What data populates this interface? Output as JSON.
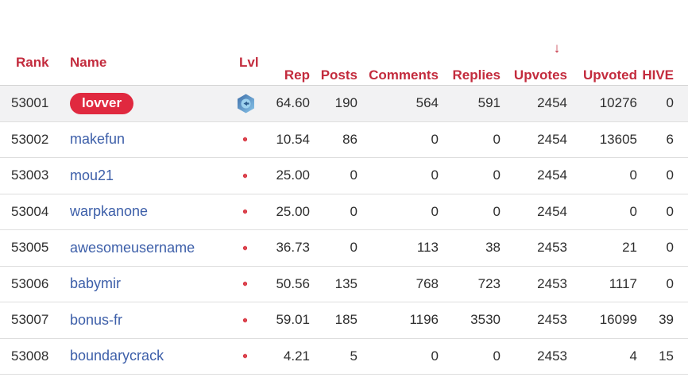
{
  "colors": {
    "header_red": "#c32b3d",
    "badge_red": "#e0293f",
    "link_blue": "#3d5fa9",
    "text_dark": "#2e2e2e",
    "highlight_row_bg": "#f2f2f3",
    "divider_gray": "#dedede",
    "level_hex_orange_top": "#f49c1c",
    "level_hex_orange_bottom": "#fcd449",
    "level_hex_blue_top": "#3f6fa9",
    "level_hex_blue_bottom": "#8ac6ea",
    "level_dot_red": "#d6303c"
  },
  "header": {
    "rank_label": "Rank",
    "name_label": "Name",
    "lvl_label": "Lvl",
    "sort_arrow": "↓",
    "sorted_column": "upvotes",
    "metric_labels": {
      "rep": "Rep",
      "posts": "Posts",
      "comments": "Comments",
      "replies": "Replies",
      "upvotes": "Upvotes",
      "upvoted": "Upvoted",
      "hive": "HIVE"
    }
  },
  "table": {
    "rows": [
      {
        "rank": "53001",
        "name": "lovver",
        "name_style": "badge",
        "row_style": "highlight",
        "level_icon": "blue",
        "rep": "64.60",
        "posts": "190",
        "comments": "564",
        "replies": "591",
        "upvotes": "2454",
        "upvoted": "10276",
        "hive": "0"
      },
      {
        "rank": "53002",
        "name": "makefun",
        "name_style": "link",
        "row_style": "",
        "level_icon": "orange",
        "rep": "10.54",
        "posts": "86",
        "comments": "0",
        "replies": "0",
        "upvotes": "2454",
        "upvoted": "13605",
        "hive": "6"
      },
      {
        "rank": "53003",
        "name": "mou21",
        "name_style": "link",
        "row_style": "",
        "level_icon": "orange",
        "rep": "25.00",
        "posts": "0",
        "comments": "0",
        "replies": "0",
        "upvotes": "2454",
        "upvoted": "0",
        "hive": "0"
      },
      {
        "rank": "53004",
        "name": "warpkanone",
        "name_style": "link",
        "row_style": "",
        "level_icon": "orange",
        "rep": "25.00",
        "posts": "0",
        "comments": "0",
        "replies": "0",
        "upvotes": "2454",
        "upvoted": "0",
        "hive": "0"
      },
      {
        "rank": "53005",
        "name": "awesomeusername",
        "name_style": "link",
        "row_style": "",
        "level_icon": "orange",
        "rep": "36.73",
        "posts": "0",
        "comments": "113",
        "replies": "38",
        "upvotes": "2453",
        "upvoted": "21",
        "hive": "0"
      },
      {
        "rank": "53006",
        "name": "babymir",
        "name_style": "link",
        "row_style": "",
        "level_icon": "orange",
        "rep": "50.56",
        "posts": "135",
        "comments": "768",
        "replies": "723",
        "upvotes": "2453",
        "upvoted": "1117",
        "hive": "0"
      },
      {
        "rank": "53007",
        "name": "bonus-fr",
        "name_style": "link",
        "row_style": "",
        "level_icon": "orange",
        "rep": "59.01",
        "posts": "185",
        "comments": "1196",
        "replies": "3530",
        "upvotes": "2453",
        "upvoted": "16099",
        "hive": "39"
      },
      {
        "rank": "53008",
        "name": "boundarycrack",
        "name_style": "link",
        "row_style": "",
        "level_icon": "orange",
        "rep": "4.21",
        "posts": "5",
        "comments": "0",
        "replies": "0",
        "upvotes": "2453",
        "upvoted": "4",
        "hive": "15"
      }
    ]
  }
}
